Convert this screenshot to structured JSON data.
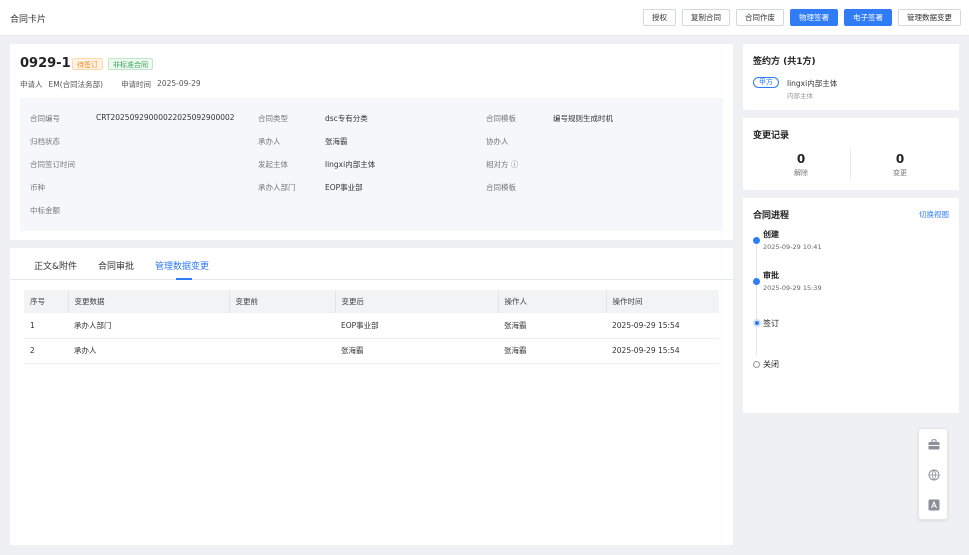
{
  "header": {
    "title": "合同卡片",
    "actions": [
      "授权",
      "复制合同",
      "合同作废",
      "物理签署",
      "电子签署",
      "管理数据变更"
    ]
  },
  "contract": {
    "number": "0929-1",
    "status_tag": "待签订",
    "type_tag": "非标准合同",
    "applicant_label": "申请人",
    "applicant": "EM(合同法务部)",
    "apply_time_label": "申请时间",
    "apply_time": "2025-09-29"
  },
  "info": {
    "c1": [
      {
        "label": "合同编号",
        "value": "CRT20250929000022025092900002"
      },
      {
        "label": "归档状态",
        "value": ""
      },
      {
        "label": "合同签订时间",
        "value": ""
      },
      {
        "label": "币种",
        "value": ""
      },
      {
        "label": "中标金额",
        "value": ""
      }
    ],
    "c2": [
      {
        "label": "合同类型",
        "value": "dsc专有分类"
      },
      {
        "label": "承办人",
        "value": "张海霸"
      },
      {
        "label": "发起主体",
        "value": "lingxi内部主体"
      },
      {
        "label": "承办人部门",
        "value": "EOP事业部"
      }
    ],
    "c3": [
      {
        "label": "合同模板",
        "value": "编号规则生成时机"
      },
      {
        "label": "协办人",
        "value": ""
      },
      {
        "label": "相对方 ⓘ",
        "value": ""
      },
      {
        "label": "合同模板",
        "value": ""
      }
    ]
  },
  "tabs": [
    "正文&附件",
    "合同审批",
    "管理数据变更"
  ],
  "table": {
    "headers": [
      "序号",
      "变更数据",
      "变更前",
      "变更后",
      "操作人",
      "操作时间"
    ],
    "rows": [
      [
        "1",
        "承办人部门",
        "",
        "EOP事业部",
        "张海霸",
        "2025-09-29 15:54"
      ],
      [
        "2",
        "承办人",
        "",
        "张海霸",
        "张海霸",
        "2025-09-29 15:54"
      ]
    ]
  },
  "signers": {
    "title": "签约方 (共1方)",
    "party_tag": "甲方",
    "party_name": "lingxi内部主体",
    "party_sub": "内部主体"
  },
  "changes": {
    "title": "变更记录",
    "items": [
      {
        "num": "0",
        "label": "解除"
      },
      {
        "num": "0",
        "label": "变更"
      }
    ]
  },
  "progress": {
    "title": "合同进程",
    "switch_label": "切换视图",
    "steps": [
      {
        "name": "创建",
        "time": "2025-09-29 10:41"
      },
      {
        "name": "审批",
        "time": "2025-09-29 15:39"
      },
      {
        "name": "签订",
        "time": ""
      },
      {
        "name": "关闭",
        "time": ""
      }
    ]
  },
  "float_icons": [
    "briefcase-icon",
    "translate-icon",
    "font-icon"
  ],
  "colors": {
    "accent": "#2f7cf6",
    "tag_orange": "#f08a24",
    "tag_green": "#3aa55d"
  }
}
